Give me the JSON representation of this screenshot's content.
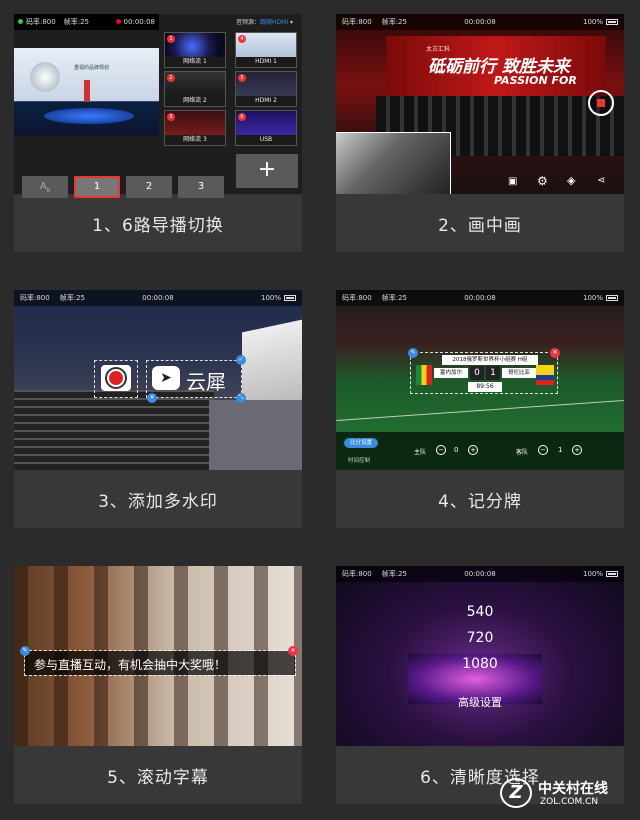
{
  "status": {
    "bitrate": "码率:800",
    "fps": "帧率:25",
    "timer": "00:00:08",
    "battery": "100%"
  },
  "panel1": {
    "caption": "1、6路导播切换",
    "audio_label": "音频源：",
    "audio_value": "跟随HDMI",
    "main_screen_text": "重视的品牌规划",
    "sources": [
      {
        "n": "1",
        "label": "网络流 1"
      },
      {
        "n": "2",
        "label": "网络流 2"
      },
      {
        "n": "3",
        "label": "网络流 3"
      },
      {
        "n": "4",
        "label": "HDMI 1"
      },
      {
        "n": "5",
        "label": "HDMI 2"
      },
      {
        "n": "6",
        "label": "USB"
      }
    ],
    "buttons": [
      "A",
      "1",
      "2",
      "3"
    ],
    "a_sub": "B",
    "add": "+"
  },
  "panel2": {
    "caption": "2、画中画",
    "banner_big": "砥砺前行 致胜未来",
    "banner_en": "PASSION FOR",
    "banner_small": "太古汇科"
  },
  "panel3": {
    "caption": "3、添加多水印",
    "logo_text": "云犀"
  },
  "panel4": {
    "caption": "4、记分牌",
    "title": "2018俄罗斯世界杯小组赛 H组",
    "home": "塞内加尔",
    "away": "哥伦比亚",
    "home_score": "0",
    "away_score": "1",
    "clock": "89:56",
    "settings_btn": "比分设置",
    "time_ctrl": "时间控制",
    "home_lbl": "主队",
    "home_val": "0",
    "away_lbl": "客队",
    "away_val": "1",
    "minus": "−",
    "plus": "+"
  },
  "panel5": {
    "caption": "5、滚动字幕",
    "ticker": "参与直播互动，有机会抽中大奖哦！"
  },
  "panel6": {
    "caption": "6、清晰度选择",
    "options": [
      "540",
      "720",
      "1080",
      "高级设置"
    ]
  },
  "watermark": {
    "cn": "中关村在线",
    "en": "ZOL.COM.CN"
  }
}
